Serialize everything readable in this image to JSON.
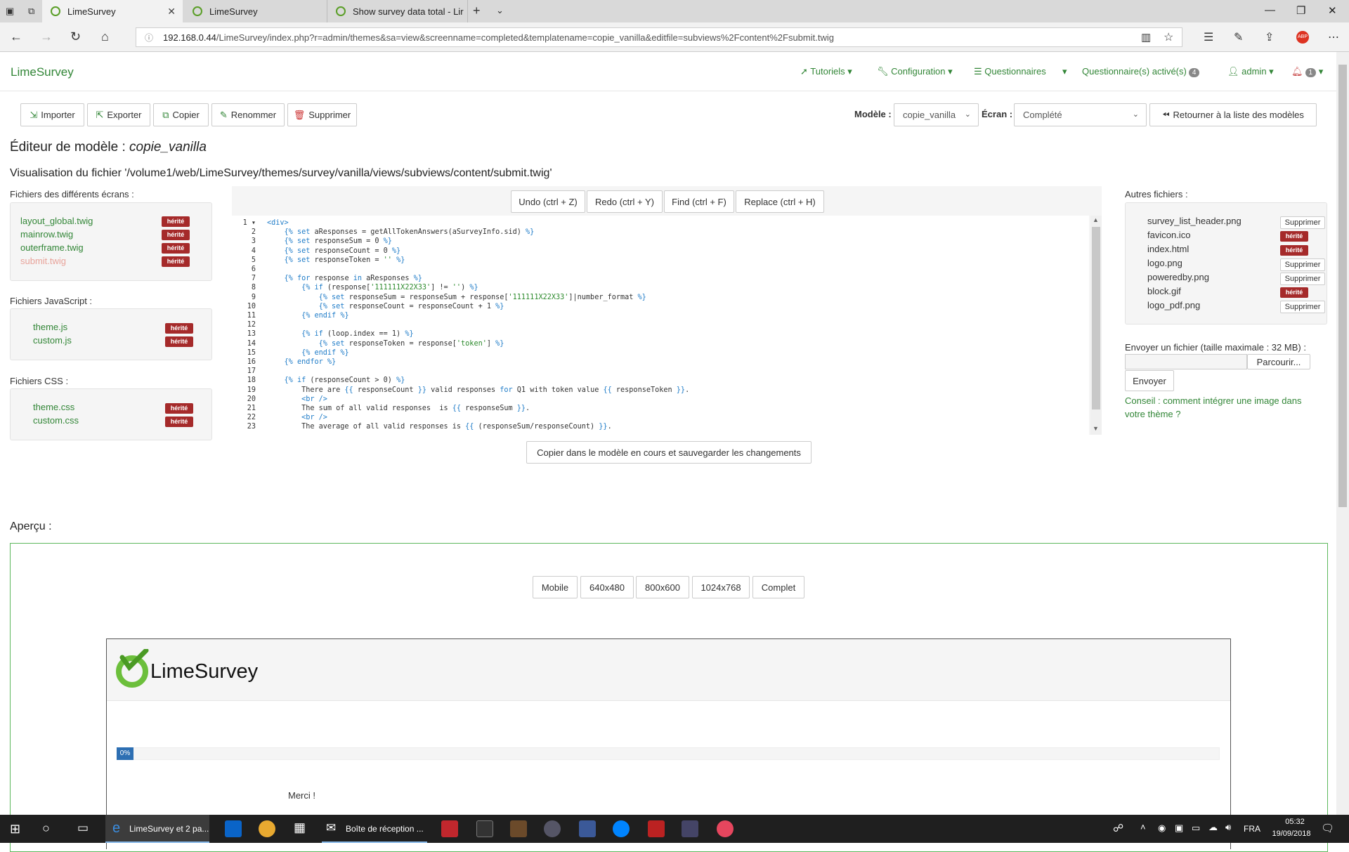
{
  "browser": {
    "tabs": [
      {
        "title": "LimeSurvey",
        "active": true
      },
      {
        "title": "LimeSurvey",
        "active": false
      },
      {
        "title": "Show survey data total - Lir",
        "active": false
      }
    ],
    "url_host": "192.168.0.44",
    "url_path": "/LimeSurvey/index.php?r=admin/themes&sa=view&screenname=completed&templatename=copie_vanilla&editfile=subviews%2Fcontent%2Fsubmit.twig"
  },
  "navbar": {
    "brand": "LimeSurvey",
    "items": [
      "Tutoriels",
      "Configuration",
      "Questionnaires"
    ],
    "active_surveys": "Questionnaire(s) activé(s)",
    "active_surveys_count": "4",
    "user": "admin",
    "notifications": "1"
  },
  "toolbar": {
    "import": "Importer",
    "export": "Exporter",
    "copy": "Copier",
    "rename": "Renommer",
    "delete": "Supprimer",
    "model_label": "Modèle :",
    "model_value": "copie_vanilla",
    "screen_label": "Écran :",
    "screen_value": "Complété",
    "back": "Retourner à la liste des modèles"
  },
  "editor": {
    "title_prefix": "Éditeur de modèle : ",
    "title_name": "copie_vanilla",
    "file_title": "Visualisation du fichier '/volume1/web/LimeSurvey/themes/survey/vanilla/views/subviews/content/submit.twig'",
    "undo": "Undo (ctrl + Z)",
    "redo": "Redo (ctrl + Y)",
    "find": "Find (ctrl + F)",
    "replace": "Replace (ctrl + H)",
    "save": "Copier dans le modèle en cours et sauvegarder les changements",
    "lines": [
      "<div>",
      "    {% set aResponses = getAllTokenAnswers(aSurveyInfo.sid) %}",
      "    {% set responseSum = 0 %}",
      "    {% set responseCount = 0 %}",
      "    {% set responseToken = '' %}",
      "",
      "    {% for response in aResponses %}",
      "        {% if (response['111111X22X33'] != '') %}",
      "            {% set responseSum = responseSum + response['111111X22X33']|number_format %}",
      "            {% set responseCount = responseCount + 1 %}",
      "        {% endif %}",
      "",
      "        {% if (loop.index == 1) %}",
      "            {% set responseToken = response['token'] %}",
      "        {% endif %}",
      "    {% endfor %}",
      "",
      "    {% if (responseCount > 0) %}",
      "        There are {{ responseCount }} valid responses for Q1 with token value {{ responseToken }}.",
      "        <br />",
      "        The sum of all valid responses  is {{ responseSum }}.",
      "        <br />",
      "        The average of all valid responses is {{ (responseSum/responseCount) }}."
    ]
  },
  "left": {
    "screens_title": "Fichiers des différents écrans :",
    "screens": [
      "layout_global.twig",
      "mainrow.twig",
      "outerframe.twig",
      "submit.twig"
    ],
    "js_title": "Fichiers JavaScript :",
    "js": [
      "theme.js",
      "custom.js"
    ],
    "css_title": "Fichiers CSS :",
    "css": [
      "theme.css",
      "custom.css"
    ],
    "inherited": "hérité"
  },
  "right": {
    "title": "Autres fichiers :",
    "files": [
      {
        "name": "survey_list_header.png",
        "action": "Supprimer"
      },
      {
        "name": "favicon.ico",
        "action": "hérité"
      },
      {
        "name": "index.html",
        "action": "hérité"
      },
      {
        "name": "logo.png",
        "action": "Supprimer"
      },
      {
        "name": "poweredby.png",
        "action": "Supprimer"
      },
      {
        "name": "block.gif",
        "action": "hérité"
      },
      {
        "name": "logo_pdf.png",
        "action": "Supprimer"
      }
    ],
    "upload_label": "Envoyer un fichier (taille maximale : 32 MB) :",
    "browse": "Parcourir...",
    "send": "Envoyer",
    "hint": "Conseil : comment intégrer une image dans votre thème ?"
  },
  "preview": {
    "title": "Aperçu :",
    "sizes": [
      "Mobile",
      "640x480",
      "800x600",
      "1024x768",
      "Complet"
    ],
    "logo_text": "LimeSurvey",
    "progress": "0%",
    "thanks": "Merci !"
  },
  "taskbar": {
    "active_app": "LimeSurvey et 2 pa...",
    "mail_app": "Boîte de réception ...",
    "lang": "FRA",
    "time": "05:32",
    "date": "19/09/2018"
  },
  "colors": {
    "brand": "#328637",
    "inherited": "#a52a2a",
    "progress": "#2d6fb3"
  }
}
